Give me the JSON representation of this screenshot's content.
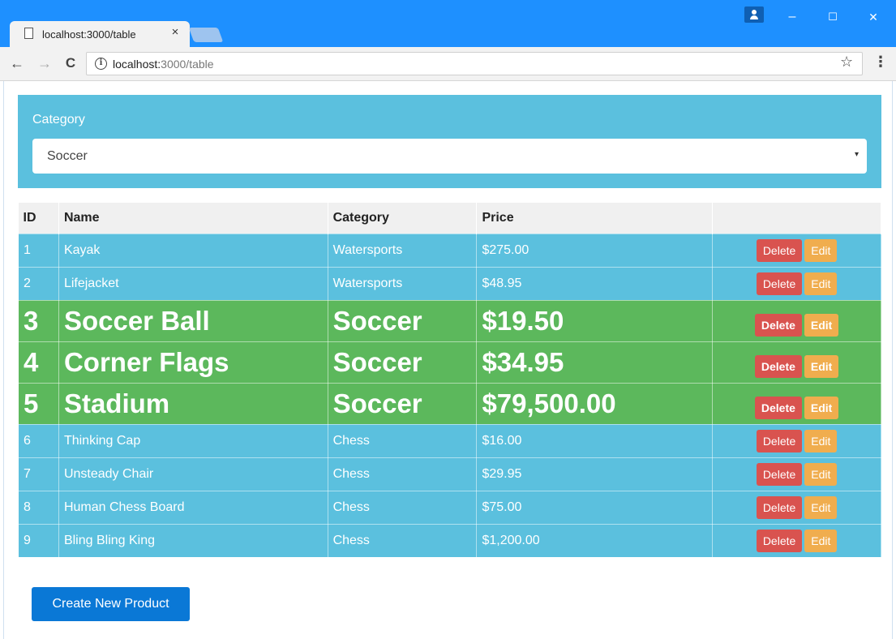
{
  "browser": {
    "tab_title": "localhost:3000/table",
    "tab_close": "×",
    "url_host": "localhost:",
    "url_path": "3000/table",
    "nav": {
      "back": "←",
      "forward": "→",
      "reload": "C"
    },
    "star": "☆",
    "menu": "⋮",
    "window": {
      "minimize": "–",
      "maximize": "☐",
      "close": "✕"
    }
  },
  "filter": {
    "label": "Category",
    "selected": "Soccer",
    "caret": "▾"
  },
  "table": {
    "headers": [
      "ID",
      "Name",
      "Category",
      "Price",
      ""
    ],
    "rows": [
      {
        "id": "1",
        "name": "Kayak",
        "category": "Watersports",
        "price": "$275.00"
      },
      {
        "id": "2",
        "name": "Lifejacket",
        "category": "Watersports",
        "price": "$48.95"
      },
      {
        "id": "3",
        "name": "Soccer Ball",
        "category": "Soccer",
        "price": "$19.50"
      },
      {
        "id": "4",
        "name": "Corner Flags",
        "category": "Soccer",
        "price": "$34.95"
      },
      {
        "id": "5",
        "name": "Stadium",
        "category": "Soccer",
        "price": "$79,500.00"
      },
      {
        "id": "6",
        "name": "Thinking Cap",
        "category": "Chess",
        "price": "$16.00"
      },
      {
        "id": "7",
        "name": "Unsteady Chair",
        "category": "Chess",
        "price": "$29.95"
      },
      {
        "id": "8",
        "name": "Human Chess Board",
        "category": "Chess",
        "price": "$75.00"
      },
      {
        "id": "9",
        "name": "Bling Bling King",
        "category": "Chess",
        "price": "$1,200.00"
      }
    ],
    "delete_label": "Delete",
    "edit_label": "Edit"
  },
  "create_label": "Create New Product",
  "colors": {
    "info_row": "#5bc0de",
    "success_row": "#5cb85c",
    "delete": "#d9534f",
    "edit": "#f0ad4e",
    "primary": "#0a78d6"
  }
}
